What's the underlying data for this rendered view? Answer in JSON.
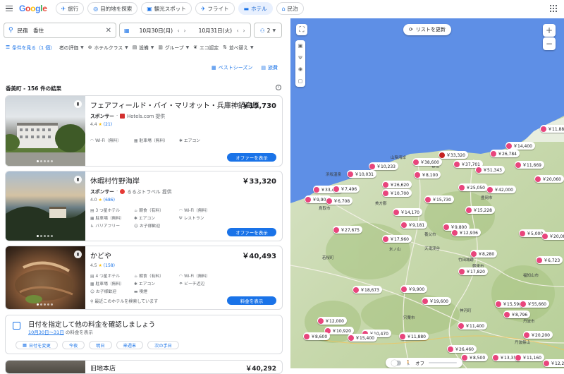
{
  "nav": {
    "logo": [
      "G",
      "o",
      "o",
      "g",
      "l",
      "e"
    ],
    "tabs": [
      {
        "label": "旅行",
        "icon": "travel-icon"
      },
      {
        "label": "目的地を探索",
        "icon": "explore-icon"
      },
      {
        "label": "観光スポット",
        "icon": "camera-icon"
      },
      {
        "label": "フライト",
        "icon": "plane-icon"
      },
      {
        "label": "ホテル",
        "icon": "bed-icon",
        "active": true
      },
      {
        "label": "民泊",
        "icon": "house-icon"
      }
    ]
  },
  "search": {
    "location": "民宿　香住",
    "checkin": "10月30日(月)",
    "checkout": "10月31日(火)",
    "guests": "2"
  },
  "filters": [
    {
      "label": "条件を見る（1 個）",
      "blue": true
    },
    {
      "label": "者の評価"
    },
    {
      "label": "ホテルクラス"
    },
    {
      "label": "設備"
    },
    {
      "label": "グループ"
    },
    {
      "label": "エコ認定"
    },
    {
      "label": "並べ替え"
    }
  ],
  "helpers": {
    "best_season": "ベストシーズン",
    "travel_cost": "旅費"
  },
  "results_header": "香美町 - 156 件の結果",
  "hotels": [
    {
      "name": "フェアフィールド・バイ・マリオット・兵庫神鍋高原",
      "price": "￥15,730",
      "sponsor": "スポンサー",
      "provider": "Hotels.com 提供",
      "provider_color": "#d32f2f",
      "rating": "4.4",
      "reviews": "(21)",
      "amenities": [
        "Wi-Fi（無料）",
        "駐車場（無料）",
        "エアコン"
      ],
      "button": "オファーを表示"
    },
    {
      "name": "休暇村竹野海岸",
      "price": "￥33,320",
      "sponsor": "スポンサー",
      "provider": "るるぶトラベル 提供",
      "provider_color": "#e53935",
      "rating": "4.0",
      "reviews": "(686)",
      "amenities": [
        "3 つ星ホテル",
        "朝食（有料）",
        "Wi-Fi（無料）",
        "駐車場（無料）",
        "エアコン",
        "レストラン",
        "バリアフリー",
        "お子様歓迎"
      ],
      "button": "オファーを表示"
    },
    {
      "name": "かどや",
      "price": "￥40,493",
      "rating": "4.5",
      "reviews": "(158)",
      "amenities": [
        "4 つ星ホテル",
        "朝食（有料）",
        "Wi-Fi（無料）",
        "駐車場（無料）",
        "エアコン",
        "ビーチ近辺",
        "お子様歓迎",
        "喫煙"
      ],
      "note": "最近このホテルを検索しています",
      "button": "料金を表示"
    }
  ],
  "date_prompt": {
    "title": "日付を指定して他の料金を確認しましょう",
    "range": "10月30日～31日",
    "suffix": " の料金を表示",
    "chips": [
      "日付を変更",
      "今夜",
      "明日",
      "来週末",
      "次の手日"
    ]
  },
  "next_hotel": {
    "name": "旧地本店",
    "price": "￥40,292"
  },
  "map": {
    "refresh": "リストを更新",
    "toggle": "オフ",
    "pins": [
      {
        "price": "￥14,400",
        "l": 305,
        "t": 175
      },
      {
        "price": "￥11,880",
        "l": 354,
        "t": 151
      },
      {
        "price": "￥26,784",
        "l": 283,
        "t": 186
      },
      {
        "price": "￥33,320",
        "l": 210,
        "t": 188,
        "hot": true
      },
      {
        "price": "￥38,600",
        "l": 173,
        "t": 198
      },
      {
        "price": "￥37,701",
        "l": 231,
        "t": 201
      },
      {
        "price": "￥51,343",
        "l": 262,
        "t": 209
      },
      {
        "price": "￥11,669",
        "l": 318,
        "t": 202
      },
      {
        "price": "￥10,233",
        "l": 111,
        "t": 204
      },
      {
        "price": "￥10,031",
        "l": 80,
        "t": 215
      },
      {
        "price": "￥8,100",
        "l": 175,
        "t": 216
      },
      {
        "price": "￥20,060",
        "l": 346,
        "t": 222
      },
      {
        "price": "￥26,620",
        "l": 130,
        "t": 230
      },
      {
        "price": "￥25,050",
        "l": 238,
        "t": 234
      },
      {
        "price": "￥42,000",
        "l": 278,
        "t": 237
      },
      {
        "price": "￥33,440",
        "l": 32,
        "t": 237
      },
      {
        "price": "￥7,496",
        "l": 60,
        "t": 236
      },
      {
        "price": "￥10,700",
        "l": 130,
        "t": 242
      },
      {
        "price": "￥9,901",
        "l": 20,
        "t": 251
      },
      {
        "price": "￥6,708",
        "l": 50,
        "t": 253
      },
      {
        "price": "￥15,730",
        "l": 190,
        "t": 251
      },
      {
        "price": "￥15,228",
        "l": 248,
        "t": 266
      },
      {
        "price": "￥14,170",
        "l": 145,
        "t": 269
      },
      {
        "price": "￥27,675",
        "l": 60,
        "t": 294
      },
      {
        "price": "￥9,181",
        "l": 156,
        "t": 287
      },
      {
        "price": "￥9,800",
        "l": 216,
        "t": 290
      },
      {
        "price": "￥12,936",
        "l": 228,
        "t": 298
      },
      {
        "price": "￥5,000",
        "l": 324,
        "t": 299
      },
      {
        "price": "￥20,081",
        "l": 356,
        "t": 303
      },
      {
        "price": "￥17,960",
        "l": 130,
        "t": 307
      },
      {
        "price": "￥8,280",
        "l": 255,
        "t": 328
      },
      {
        "price": "￥6,723",
        "l": 348,
        "t": 337
      },
      {
        "price": "￥17,820",
        "l": 238,
        "t": 353
      },
      {
        "price": "￥18,673",
        "l": 88,
        "t": 379
      },
      {
        "price": "￥9,900",
        "l": 156,
        "t": 378
      },
      {
        "price": "￥19,600",
        "l": 186,
        "t": 395
      },
      {
        "price": "￥15,590",
        "l": 290,
        "t": 399
      },
      {
        "price": "￥55,660",
        "l": 325,
        "t": 399
      },
      {
        "price": "￥8,796",
        "l": 302,
        "t": 414
      },
      {
        "price": "￥12,000",
        "l": 38,
        "t": 423
      },
      {
        "price": "￥11,400",
        "l": 237,
        "t": 430
      },
      {
        "price": "￥10,920",
        "l": 48,
        "t": 437
      },
      {
        "price": "￥10,470",
        "l": 101,
        "t": 441
      },
      {
        "price": "￥11,880",
        "l": 154,
        "t": 445
      },
      {
        "price": "￥8,600",
        "l": 18,
        "t": 445
      },
      {
        "price": "￥15,400",
        "l": 81,
        "t": 447
      },
      {
        "price": "￥20,200",
        "l": 330,
        "t": 443
      },
      {
        "price": "￥26,460",
        "l": 222,
        "t": 463
      },
      {
        "price": "￥8,500",
        "l": 242,
        "t": 475
      },
      {
        "price": "￥13,350",
        "l": 286,
        "t": 475
      },
      {
        "price": "￥11,160",
        "l": 318,
        "t": 475
      },
      {
        "price": "￥12,200",
        "l": 358,
        "t": 483
      }
    ],
    "labels": [
      {
        "text": "浜坂温泉",
        "l": 50,
        "t": 217
      },
      {
        "text": "香住",
        "l": 200,
        "t": 205
      },
      {
        "text": "山陰海岸",
        "l": 142,
        "t": 193
      },
      {
        "text": "美方郡",
        "l": 120,
        "t": 258
      },
      {
        "text": "豊岡市",
        "l": 270,
        "t": 250
      },
      {
        "text": "養父市",
        "l": 190,
        "t": 302
      },
      {
        "text": "朝来市",
        "l": 258,
        "t": 347
      },
      {
        "text": "宍粟市",
        "l": 160,
        "t": 420
      },
      {
        "text": "鳥取市",
        "l": 40,
        "t": 265
      },
      {
        "text": "若桜町",
        "l": 45,
        "t": 335
      },
      {
        "text": "丹波市",
        "l": 330,
        "t": 425
      },
      {
        "text": "丹波篠山",
        "l": 318,
        "t": 455
      },
      {
        "text": "氷ノ山",
        "l": 140,
        "t": 323
      },
      {
        "text": "天滝渓谷",
        "l": 190,
        "t": 322
      },
      {
        "text": "竹田城跡",
        "l": 238,
        "t": 338
      },
      {
        "text": "福知山市",
        "l": 330,
        "t": 360
      },
      {
        "text": "京丹後",
        "l": 318,
        "t": 178
      },
      {
        "text": "神河町",
        "l": 240,
        "t": 410
      }
    ]
  }
}
